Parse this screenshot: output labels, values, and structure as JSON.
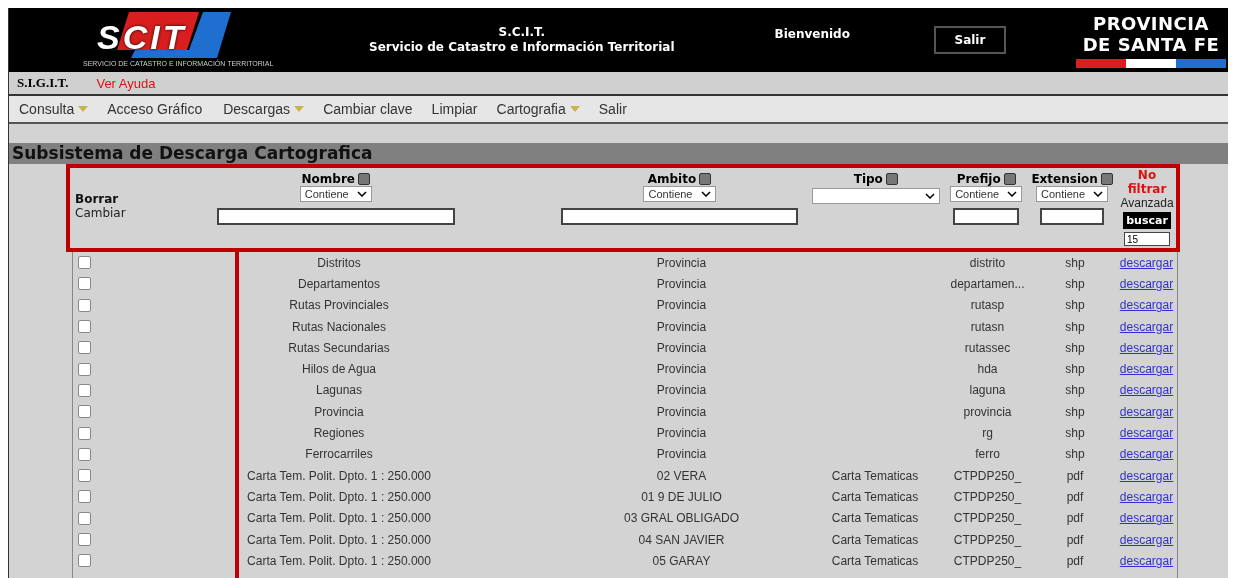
{
  "header": {
    "logo_text": "SCIT",
    "logo_subtitle": "SERVICIO DE CATASTRO E INFORMACIÓN TERRITORIAL",
    "title": "S.C.I.T.",
    "subtitle": "Servicio de Catastro e Información Territorial",
    "welcome": "Bienvenido",
    "logout_button": "Salir",
    "province_logo": [
      "PROVINCIA",
      "DE SANTA FE"
    ]
  },
  "sub_bar": {
    "system": "S.I.G.I.T.",
    "help_link": "Ver Ayuda"
  },
  "menu": [
    {
      "label": "Consulta",
      "dropdown": true
    },
    {
      "label": "Acceso Gráfico",
      "dropdown": false
    },
    {
      "label": "Descargas",
      "dropdown": true
    },
    {
      "label": "Cambiar clave",
      "dropdown": false
    },
    {
      "label": "Limpiar",
      "dropdown": false
    },
    {
      "label": "Cartografia",
      "dropdown": true
    },
    {
      "label": "Salir",
      "dropdown": false
    }
  ],
  "page_title": "Subsistema de Descarga Cartografica",
  "filters": {
    "clear": "Borrar",
    "change": "Cambiar",
    "columns": [
      {
        "label": "Nombre",
        "checked": false,
        "operator": "Contiene",
        "kind": "text"
      },
      {
        "label": "Ambito",
        "checked": false,
        "operator": "Contiene",
        "kind": "text"
      },
      {
        "label": "Tipo",
        "checked": false,
        "kind": "select"
      },
      {
        "label": "Prefijo",
        "checked": false,
        "operator": "Contiene",
        "kind": "text"
      },
      {
        "label": "Extension",
        "checked": false,
        "operator": "Contiene",
        "kind": "text"
      }
    ],
    "no_filter": "No filtrar",
    "advanced": "Avanzada",
    "search_button": "buscar",
    "page_size": "15"
  },
  "rows": [
    {
      "checked": false,
      "nombre": "Distritos",
      "ambito": "Provincia",
      "prefijo": "distrito",
      "extension": "shp",
      "link": "descargar"
    },
    {
      "checked": false,
      "nombre": "Departamentos",
      "ambito": "Provincia",
      "prefijo": "departamen...",
      "extension": "shp",
      "link": "descargar"
    },
    {
      "checked": false,
      "nombre": "Rutas Provinciales",
      "ambito": "Provincia",
      "prefijo": "rutasp",
      "extension": "shp",
      "link": "descargar"
    },
    {
      "checked": false,
      "nombre": "Rutas Nacionales",
      "ambito": "Provincia",
      "prefijo": "rutasn",
      "extension": "shp",
      "link": "descargar"
    },
    {
      "checked": false,
      "nombre": "Rutas Secundarias",
      "ambito": "Provincia",
      "prefijo": "rutassec",
      "extension": "shp",
      "link": "descargar"
    },
    {
      "checked": false,
      "nombre": "Hilos de Agua",
      "ambito": "Provincia",
      "prefijo": "hda",
      "extension": "shp",
      "link": "descargar"
    },
    {
      "checked": false,
      "nombre": "Lagunas",
      "ambito": "Provincia",
      "prefijo": "laguna",
      "extension": "shp",
      "link": "descargar"
    },
    {
      "checked": false,
      "nombre": "Provincia",
      "ambito": "Provincia",
      "prefijo": "provincia",
      "extension": "shp",
      "link": "descargar"
    },
    {
      "checked": false,
      "nombre": "Regiones",
      "ambito": "Provincia",
      "prefijo": "rg",
      "extension": "shp",
      "link": "descargar"
    },
    {
      "checked": false,
      "nombre": "Ferrocarriles",
      "ambito": "Provincia",
      "prefijo": "ferro",
      "extension": "shp",
      "link": "descargar"
    },
    {
      "checked": false,
      "nombre": "Carta Tem. Polit. Dpto. 1 : 250.000",
      "ambito": "02 VERA",
      "tipo": "Carta Tematicas",
      "prefijo": "CTPDP250_",
      "extension": "pdf",
      "link": "descargar"
    },
    {
      "checked": false,
      "nombre": "Carta Tem. Polit. Dpto. 1 : 250.000",
      "ambito": "01 9 DE JULIO",
      "tipo": "Carta Tematicas",
      "prefijo": "CTPDP250_",
      "extension": "pdf",
      "link": "descargar"
    },
    {
      "checked": false,
      "nombre": "Carta Tem. Polit. Dpto. 1 : 250.000",
      "ambito": "03 GRAL OBLIGADO",
      "tipo": "Carta Tematicas",
      "prefijo": "CTPDP250_",
      "extension": "pdf",
      "link": "descargar"
    },
    {
      "checked": false,
      "nombre": "Carta Tem. Polit. Dpto. 1 : 250.000",
      "ambito": "04 SAN JAVIER",
      "tipo": "Carta Tematicas",
      "prefijo": "CTPDP250_",
      "extension": "pdf",
      "link": "descargar"
    },
    {
      "checked": false,
      "nombre": "Carta Tem. Polit. Dpto. 1 : 250.000",
      "ambito": "05 GARAY",
      "tipo": "Carta Tematicas",
      "prefijo": "CTPDP250_",
      "extension": "pdf",
      "link": "descargar"
    }
  ]
}
